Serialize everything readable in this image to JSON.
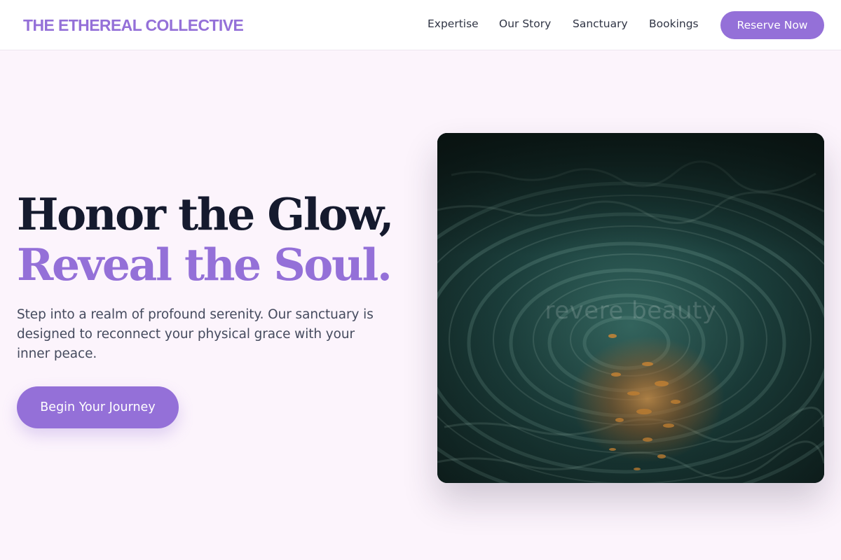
{
  "header": {
    "brand": "THE ETHEREAL COLLECTIVE",
    "nav": [
      "Expertise",
      "Our Story",
      "Sanctuary",
      "Bookings"
    ],
    "cta_label": "Reserve Now"
  },
  "hero": {
    "headline_line1": "Honor the Glow,",
    "headline_line2": "Reveal the Soul.",
    "description": "Step into a realm of profound serenity. Our sanctuary is designed to reconnect your physical grace with your inner peace.",
    "cta_label": "Begin Your Journey",
    "image": {
      "subject": "rippling dark teal water with warm orange light reflections",
      "watermark": "revere beauty"
    }
  },
  "colors": {
    "brand": "#9470d8",
    "heading": "#151a2e",
    "body_text": "#454b5e",
    "page_background": "#fcf4fc",
    "water_dark": "#0f1f1e",
    "water_teal": "#5f9a8f",
    "glow_orange": "#f29a3a"
  }
}
